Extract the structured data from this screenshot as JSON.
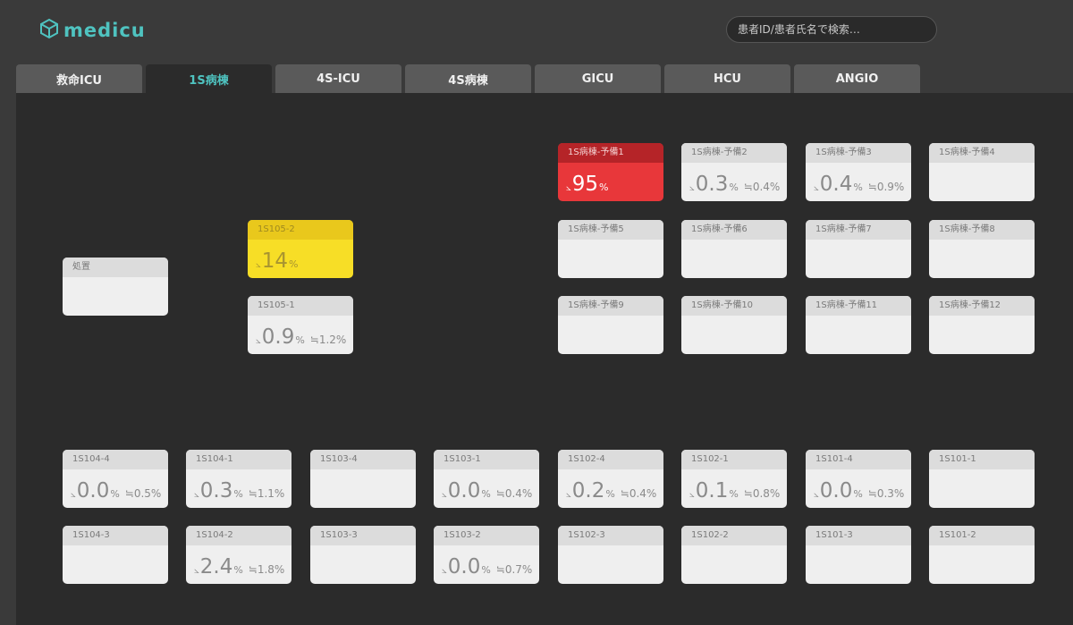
{
  "header": {
    "logo_text": "medicu",
    "search_placeholder": "患者ID/患者氏名で検索…"
  },
  "tabs": [
    {
      "label": "救命ICU"
    },
    {
      "label": "1S病棟"
    },
    {
      "label": "4S-ICU"
    },
    {
      "label": "4S病棟"
    },
    {
      "label": "GICU"
    },
    {
      "label": "HCU"
    },
    {
      "label": "ANGIO"
    }
  ],
  "active_tab": "1S病棟",
  "colors": {
    "accent": "#4fc3c0",
    "alert_red": "#e8373a",
    "warning_yellow": "#f7de26"
  },
  "beds": [
    {
      "id": "b01",
      "name": "1S病棟-予備1",
      "value": "95",
      "unit": "%",
      "sub": "",
      "status": "red"
    },
    {
      "id": "b02",
      "name": "1S病棟-予備2",
      "value": "0.3",
      "unit": "%",
      "sub": "≒0.4%",
      "status": "normal"
    },
    {
      "id": "b03",
      "name": "1S病棟-予備3",
      "value": "0.4",
      "unit": "%",
      "sub": "≒0.9%",
      "status": "normal"
    },
    {
      "id": "b04",
      "name": "1S病棟-予備4",
      "value": "",
      "unit": "",
      "sub": "",
      "status": "normal"
    },
    {
      "id": "b05",
      "name": "1S105-2",
      "value": "14",
      "unit": "%",
      "sub": "",
      "status": "yellow"
    },
    {
      "id": "b06",
      "name": "1S病棟-予備5",
      "value": "",
      "unit": "",
      "sub": "",
      "status": "normal"
    },
    {
      "id": "b07",
      "name": "1S病棟-予備6",
      "value": "",
      "unit": "",
      "sub": "",
      "status": "normal"
    },
    {
      "id": "b08",
      "name": "1S病棟-予備7",
      "value": "",
      "unit": "",
      "sub": "",
      "status": "normal"
    },
    {
      "id": "b09",
      "name": "1S病棟-予備8",
      "value": "",
      "unit": "",
      "sub": "",
      "status": "normal"
    },
    {
      "id": "b10",
      "name": "処置",
      "value": "",
      "unit": "",
      "sub": "",
      "status": "normal"
    },
    {
      "id": "b11",
      "name": "1S105-1",
      "value": "0.9",
      "unit": "%",
      "sub": "≒1.2%",
      "status": "normal"
    },
    {
      "id": "b12",
      "name": "1S病棟-予備9",
      "value": "",
      "unit": "",
      "sub": "",
      "status": "normal"
    },
    {
      "id": "b13",
      "name": "1S病棟-予備10",
      "value": "",
      "unit": "",
      "sub": "",
      "status": "normal"
    },
    {
      "id": "b14",
      "name": "1S病棟-予備11",
      "value": "",
      "unit": "",
      "sub": "",
      "status": "normal"
    },
    {
      "id": "b15",
      "name": "1S病棟-予備12",
      "value": "",
      "unit": "",
      "sub": "",
      "status": "normal"
    },
    {
      "id": "b16",
      "name": "1S104-4",
      "value": "0.0",
      "unit": "%",
      "sub": "≒0.5%",
      "status": "normal"
    },
    {
      "id": "b17",
      "name": "1S104-1",
      "value": "0.3",
      "unit": "%",
      "sub": "≒1.1%",
      "status": "normal"
    },
    {
      "id": "b18",
      "name": "1S103-4",
      "value": "",
      "unit": "",
      "sub": "",
      "status": "normal"
    },
    {
      "id": "b19",
      "name": "1S103-1",
      "value": "0.0",
      "unit": "%",
      "sub": "≒0.4%",
      "status": "normal"
    },
    {
      "id": "b20",
      "name": "1S102-4",
      "value": "0.2",
      "unit": "%",
      "sub": "≒0.4%",
      "status": "normal"
    },
    {
      "id": "b21",
      "name": "1S102-1",
      "value": "0.1",
      "unit": "%",
      "sub": "≒0.8%",
      "status": "normal"
    },
    {
      "id": "b22",
      "name": "1S101-4",
      "value": "0.0",
      "unit": "%",
      "sub": "≒0.3%",
      "status": "normal"
    },
    {
      "id": "b23",
      "name": "1S101-1",
      "value": "",
      "unit": "",
      "sub": "",
      "status": "normal"
    },
    {
      "id": "b24",
      "name": "1S104-3",
      "value": "",
      "unit": "",
      "sub": "",
      "status": "normal"
    },
    {
      "id": "b25",
      "name": "1S104-2",
      "value": "2.4",
      "unit": "%",
      "sub": "≒1.8%",
      "status": "normal"
    },
    {
      "id": "b26",
      "name": "1S103-3",
      "value": "",
      "unit": "",
      "sub": "",
      "status": "normal"
    },
    {
      "id": "b27",
      "name": "1S103-2",
      "value": "0.0",
      "unit": "%",
      "sub": "≒0.7%",
      "status": "normal"
    },
    {
      "id": "b28",
      "name": "1S102-3",
      "value": "",
      "unit": "",
      "sub": "",
      "status": "normal"
    },
    {
      "id": "b29",
      "name": "1S102-2",
      "value": "",
      "unit": "",
      "sub": "",
      "status": "normal"
    },
    {
      "id": "b30",
      "name": "1S101-3",
      "value": "",
      "unit": "",
      "sub": "",
      "status": "normal"
    },
    {
      "id": "b31",
      "name": "1S101-2",
      "value": "",
      "unit": "",
      "sub": "",
      "status": "normal"
    }
  ]
}
